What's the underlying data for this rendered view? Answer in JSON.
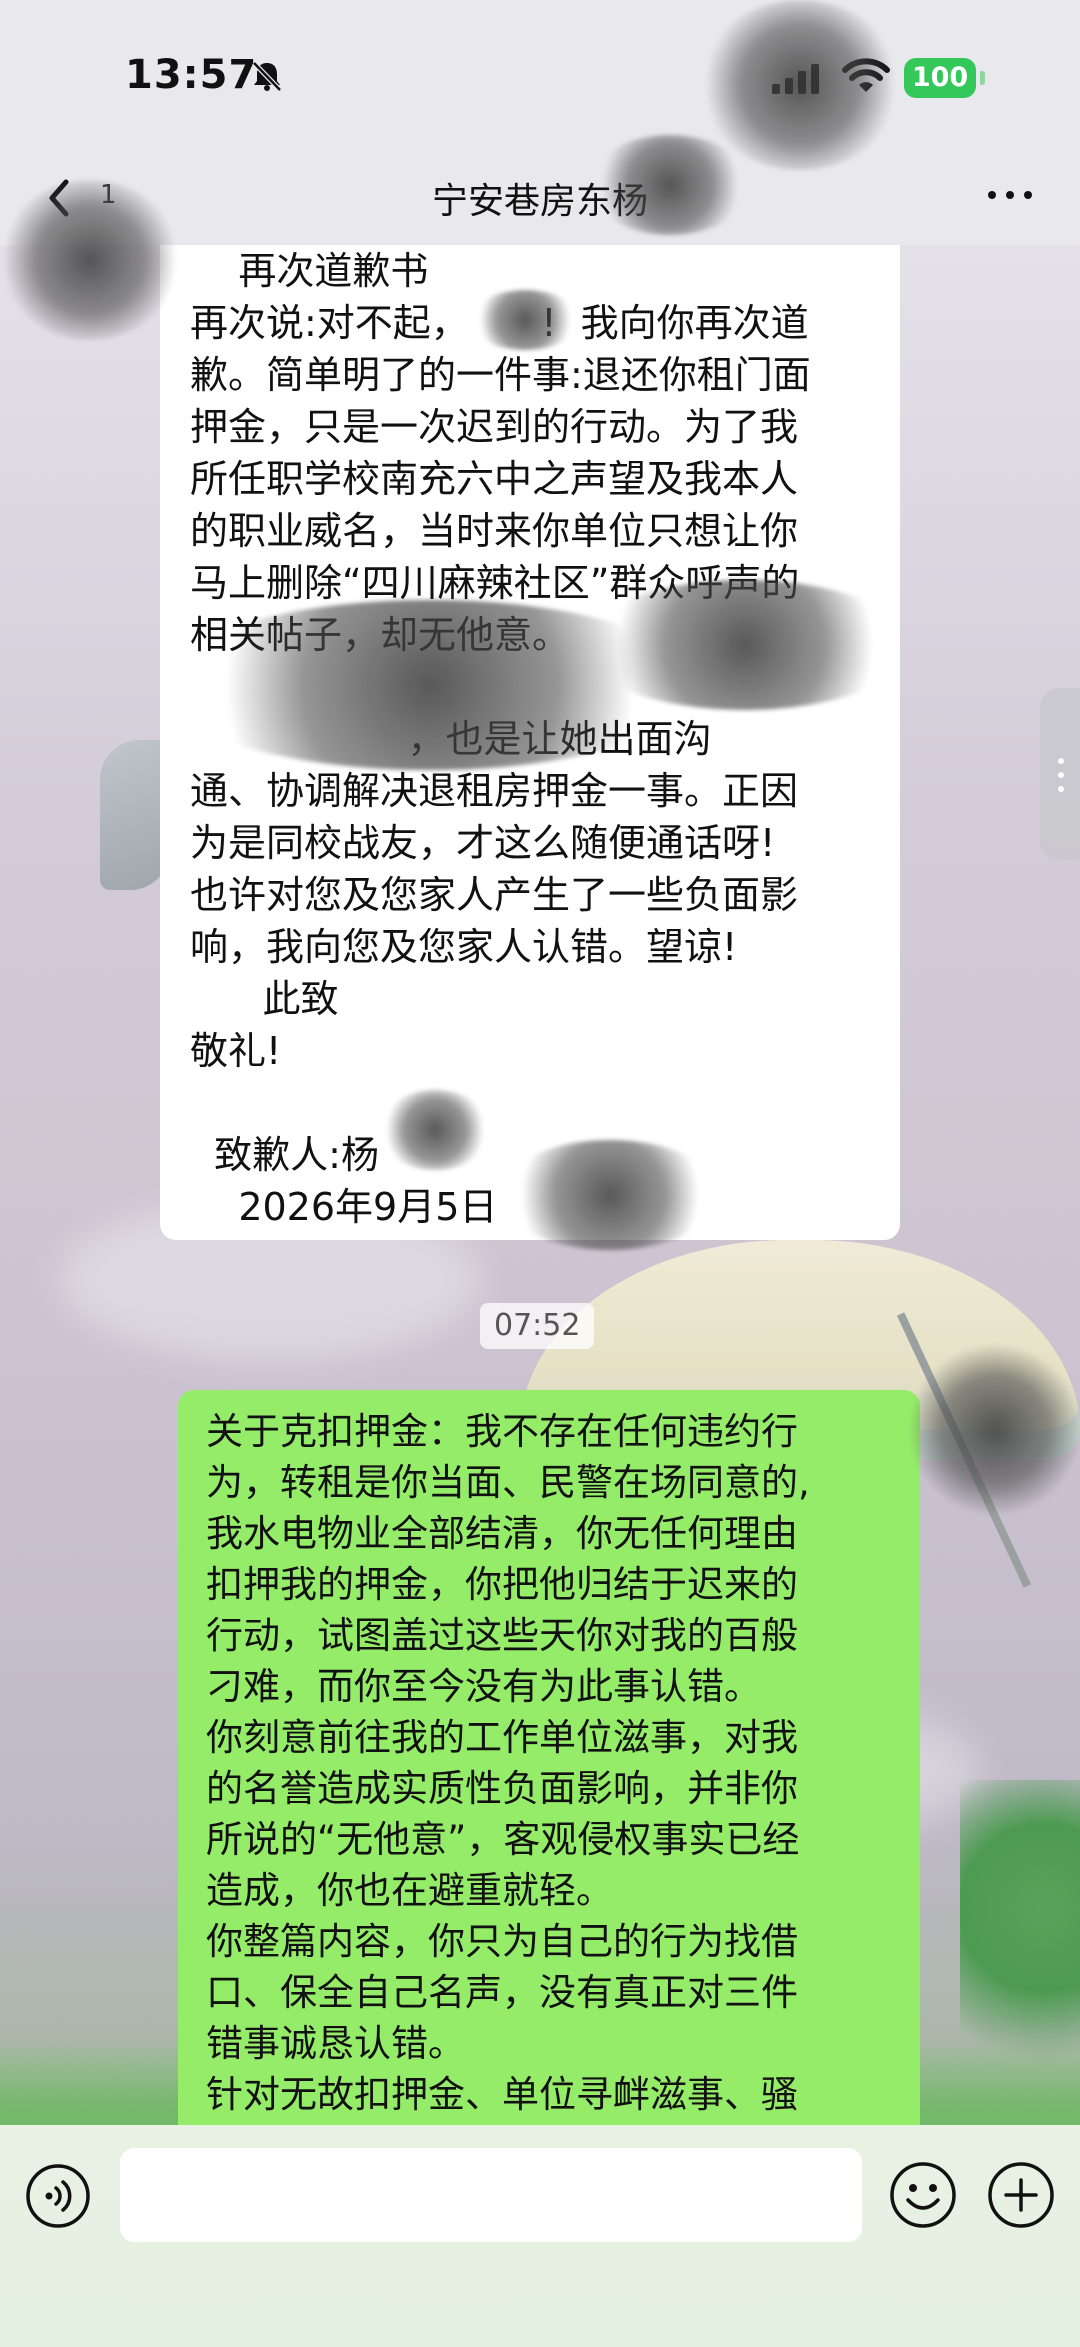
{
  "status_bar": {
    "time": "13:57",
    "battery": "100",
    "icons": [
      "mute-icon",
      "signal-icon",
      "wifi-icon",
      "battery-icon"
    ]
  },
  "nav": {
    "title": "宁安巷房东杨",
    "unread_count": "1",
    "back_icon": "chevron-left-icon",
    "more_icon": "more-dots-icon"
  },
  "messages": {
    "incoming_text": "    再次道歉书\n再次说:对不起，      !  我向你再次道\n歉。简单明了的一件事:退还你租门面\n押金，只是一次迟到的行动。为了我\n所任职学校南充六中之声望及我本人\n的职业威名，当时来你单位只想让你\n马上删除“四川麻辣社区”群众呼声的\n相关帖子，却无他意。\n\n                  ，也是让她出面沟\n通、协调解决退租房押金一事。正因\n为是同校战友，才这么随便通话呀!\n也许对您及您家人产生了一些负面影\n响，我向您及您家人认错。望谅!\n      此致\n敬礼!\n\n  致歉人:杨\n    2026年9月5日",
    "timestamp": "07:52",
    "outgoing_text": "关于克扣押金：我不存在任何违约行\n为，转租是你当面、民警在场同意的,\n我水电物业全部结清，你无任何理由\n扣押我的押金，你把他归结于迟来的\n行动，试图盖过这些天你对我的百般\n刁难，而你至今没有为此事认错。\n你刻意前往我的工作单位滋事，对我\n的名誉造成实质性负面影响，并非你\n所说的“无他意”，客观侵权事实已经\n造成，你也在避重就轻。\n你整篇内容，你只为自己的行为找借\n口、保全自己名声，没有真正对三件\n错事诚恳认错。\n针对无故扣押金、单位寻衅滋事、骚"
  },
  "input_bar": {
    "placeholder": "",
    "icons": [
      "voice-icon",
      "emoji-icon",
      "plus-icon"
    ]
  },
  "colors": {
    "outgoing_bubble": "#95ec69",
    "incoming_bubble": "#ffffff",
    "battery": "#34c759"
  }
}
